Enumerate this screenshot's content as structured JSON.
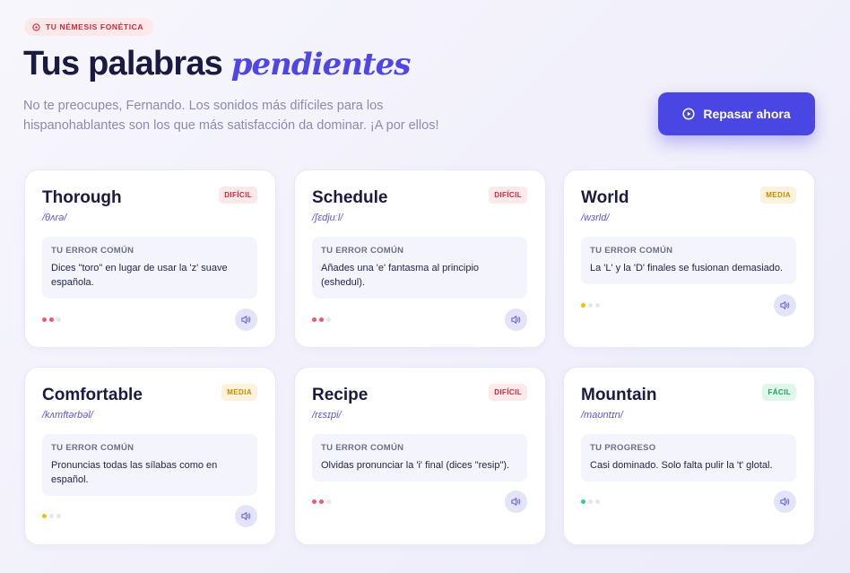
{
  "header": {
    "badge": "TU NÉMESIS FONÉTICA",
    "title_main": "Tus palabras",
    "title_accent": "pendientes",
    "subtitle": "No te preocupes, Fernando. Los sonidos más difíciles para los hispanohablantes son los que más satisfacción da dominar. ¡A por ellos!",
    "cta_label": "Repasar ahora"
  },
  "colors": {
    "accent": "#4a46e3",
    "difficult": "#ec5a72",
    "medium": "#f2c200",
    "easy": "#2fcf86",
    "inactive": "#e5e6ee"
  },
  "cards": [
    {
      "word": "Thorough",
      "ipa": "/θʌrə/",
      "level": "DIFÍCIL",
      "level_type": "dificil",
      "box_label": "TU ERROR COMÚN",
      "box_text": "Dices \"toro\" en lugar de usar la 'z' suave española.",
      "progress": {
        "filled": 2,
        "total": 3,
        "color": "#ec5a72"
      },
      "speaker_icon": "speaker-icon"
    },
    {
      "word": "Schedule",
      "ipa": "/ʃɛdjuːl/",
      "level": "DIFÍCIL",
      "level_type": "dificil",
      "box_label": "TU ERROR COMÚN",
      "box_text": "Añades una 'e' fantasma al principio (eshedul).",
      "progress": {
        "filled": 2,
        "total": 3,
        "color": "#ec5a72"
      },
      "speaker_icon": "speaker-icon"
    },
    {
      "word": "World",
      "ipa": "/wɜrld/",
      "level": "MEDIA",
      "level_type": "media",
      "box_label": "TU ERROR COMÚN",
      "box_text": "La 'L' y la 'D' finales se fusionan demasiado.",
      "progress": {
        "filled": 1,
        "total": 3,
        "color": "#f2c200"
      },
      "speaker_icon": "speaker-icon"
    },
    {
      "word": "Comfortable",
      "ipa": "/kʌmftərbəl/",
      "level": "MEDIA",
      "level_type": "media",
      "box_label": "TU ERROR COMÚN",
      "box_text": "Pronuncias todas las sílabas como en español.",
      "progress": {
        "filled": 1,
        "total": 3,
        "color": "#f2c200"
      },
      "speaker_icon": "speaker-icon"
    },
    {
      "word": "Recipe",
      "ipa": "/rɛsɪpi/",
      "level": "DIFÍCIL",
      "level_type": "dificil",
      "box_label": "TU ERROR COMÚN",
      "box_text": "Olvidas pronunciar la 'i' final (dices \"resip\").",
      "progress": {
        "filled": 2,
        "total": 3,
        "color": "#ec5a72"
      },
      "speaker_icon": "speaker-icon"
    },
    {
      "word": "Mountain",
      "ipa": "/maʊntɪn/",
      "level": "FÁCIL",
      "level_type": "facil",
      "box_label": "TU PROGRESO",
      "box_text": "Casi dominado. Solo falta pulir la 't' glotal.",
      "progress": {
        "filled": 1,
        "total": 3,
        "color": "#2fcf86"
      },
      "speaker_icon": "speaker-icon"
    }
  ]
}
